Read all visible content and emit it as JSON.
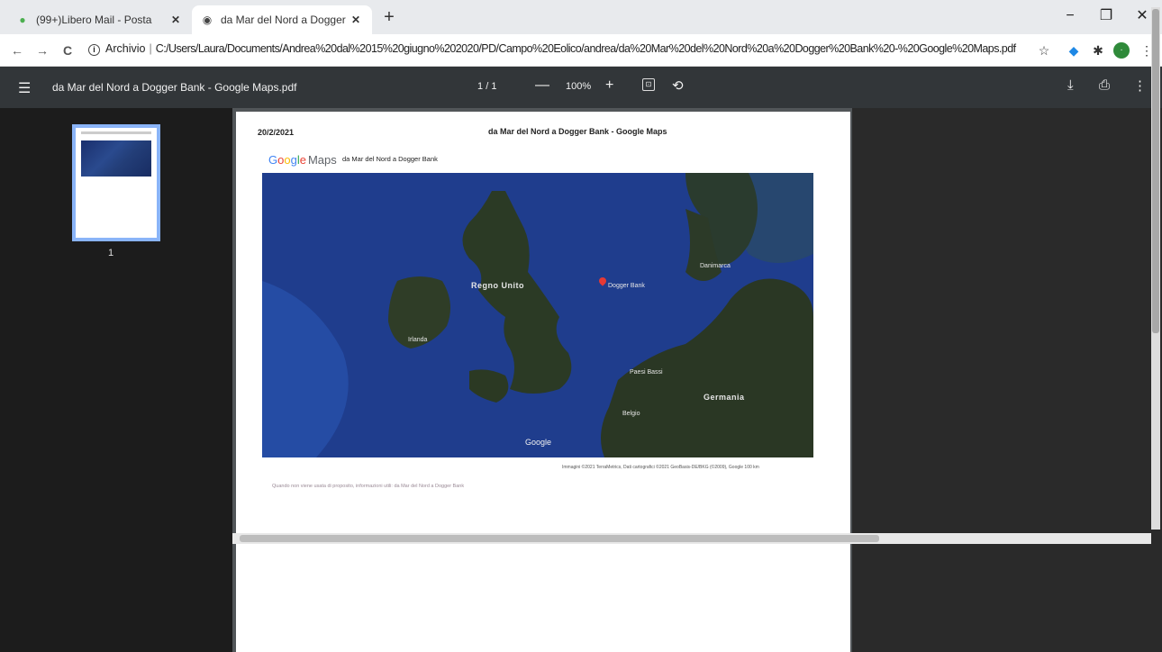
{
  "tabs": [
    {
      "title": "(99+)Libero Mail - Posta",
      "close": "✕"
    },
    {
      "title": "da Mar del Nord a Dogger Bank",
      "close": "✕"
    }
  ],
  "new_tab": "+",
  "window_controls": {
    "minimize": "−",
    "maximize": "❐",
    "close": "✕"
  },
  "address": {
    "back": "←",
    "forward": "→",
    "reload": "C",
    "info": "i",
    "scheme_label": "Archivio",
    "separator": "|",
    "url": "C:/Users/Laura/Documents/Andrea%20dal%2015%20giugno%202020/PD/Campo%20Eolico/andrea/da%20Mar%20del%20Nord%20a%20Dogger%20Bank%20-%20Google%20Maps.pdf"
  },
  "extensions": {
    "star": "☆",
    "ext1": "◆",
    "puzzle": "✱",
    "profile": "·",
    "menu": "⋮"
  },
  "pdf_toolbar": {
    "menu": "☰",
    "title": "da Mar del Nord a Dogger Bank - Google Maps.pdf",
    "page_current": "1",
    "page_sep": "/",
    "page_total": "1",
    "zoom_out": "—",
    "zoom": "100%",
    "zoom_in": "+",
    "fit": "⊡",
    "rotate": "⟲",
    "download": "⤓",
    "print": "⎙",
    "more": "⋮"
  },
  "sidebar": {
    "thumbnail_page": "1"
  },
  "page": {
    "date": "20/2/2021",
    "header_title": "da Mar del Nord a Dogger Bank - Google Maps",
    "logo_maps": "Maps",
    "route_title": "da Mar del Nord a Dogger Bank",
    "map_labels": {
      "regno_unito": "Regno Unito",
      "irlanda": "Irlanda",
      "germania": "Germania",
      "danimarca": "Danimarca",
      "paesi_bassi": "Paesi Bassi",
      "belgio": "Belgio",
      "dogger_bank": "Dogger Bank"
    },
    "map_watermark": "Google",
    "attribution": "Immagini ©2021 TerraMetrics, Dati cartografici ©2021 GeoBasis-DE/BKG (©2009), Google   100 km",
    "note": "Quando non viene usata di proposito, informazioni utili: da Mar del Nord a Dogger Bank"
  }
}
